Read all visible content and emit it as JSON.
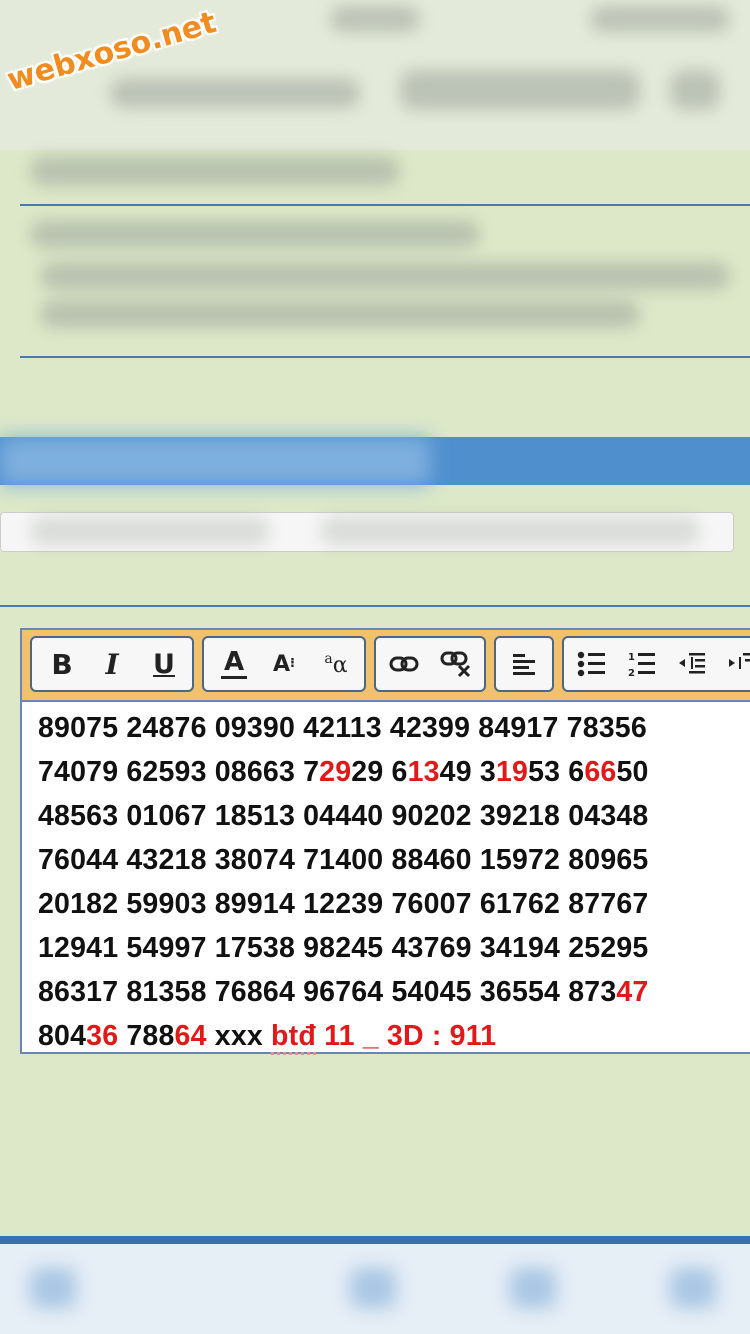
{
  "watermark": "webxoso.net",
  "toolbar": {
    "bold": "B",
    "italic": "I",
    "underline": "U",
    "font_color": "A",
    "font_size": "A",
    "font_family": "a"
  },
  "editor": {
    "lines": [
      [
        {
          "t": "89075 24876 09390 42113 42399 84917 78356"
        }
      ],
      [
        {
          "t": "74079 62593 08663 7"
        },
        {
          "t": "29",
          "red": true
        },
        {
          "t": "29 6"
        },
        {
          "t": "13",
          "red": true
        },
        {
          "t": "49 3"
        },
        {
          "t": "19",
          "red": true
        },
        {
          "t": "53 6"
        },
        {
          "t": "66",
          "red": true
        },
        {
          "t": "50"
        }
      ],
      [
        {
          "t": "48563 01067 18513 04440 90202 39218 04348"
        }
      ],
      [
        {
          "t": "76044 43218 38074 71400 88460 15972 80965"
        }
      ],
      [
        {
          "t": "20182 59903 89914 12239 76007 61762 87767"
        }
      ],
      [
        {
          "t": "12941 54997 17538 98245 43769 34194 25295"
        }
      ],
      [
        {
          "t": "86317 81358 76864 96764 54045 36554 873"
        },
        {
          "t": "47",
          "red": true
        }
      ],
      [
        {
          "t": "804"
        },
        {
          "t": "36",
          "red": true
        },
        {
          "t": " 788"
        },
        {
          "t": "64",
          "red": true
        },
        {
          "t": " xxx "
        },
        {
          "t": "btđ",
          "red": true,
          "spell": true
        },
        {
          "t": " 11 _ 3D : 911",
          "red": true
        }
      ]
    ]
  },
  "colors": {
    "highlight_red": "#e01919",
    "toolbar_bg": "#f2c16e",
    "page_bg": "#dde8c8",
    "accent_blue": "#4f8fce"
  }
}
